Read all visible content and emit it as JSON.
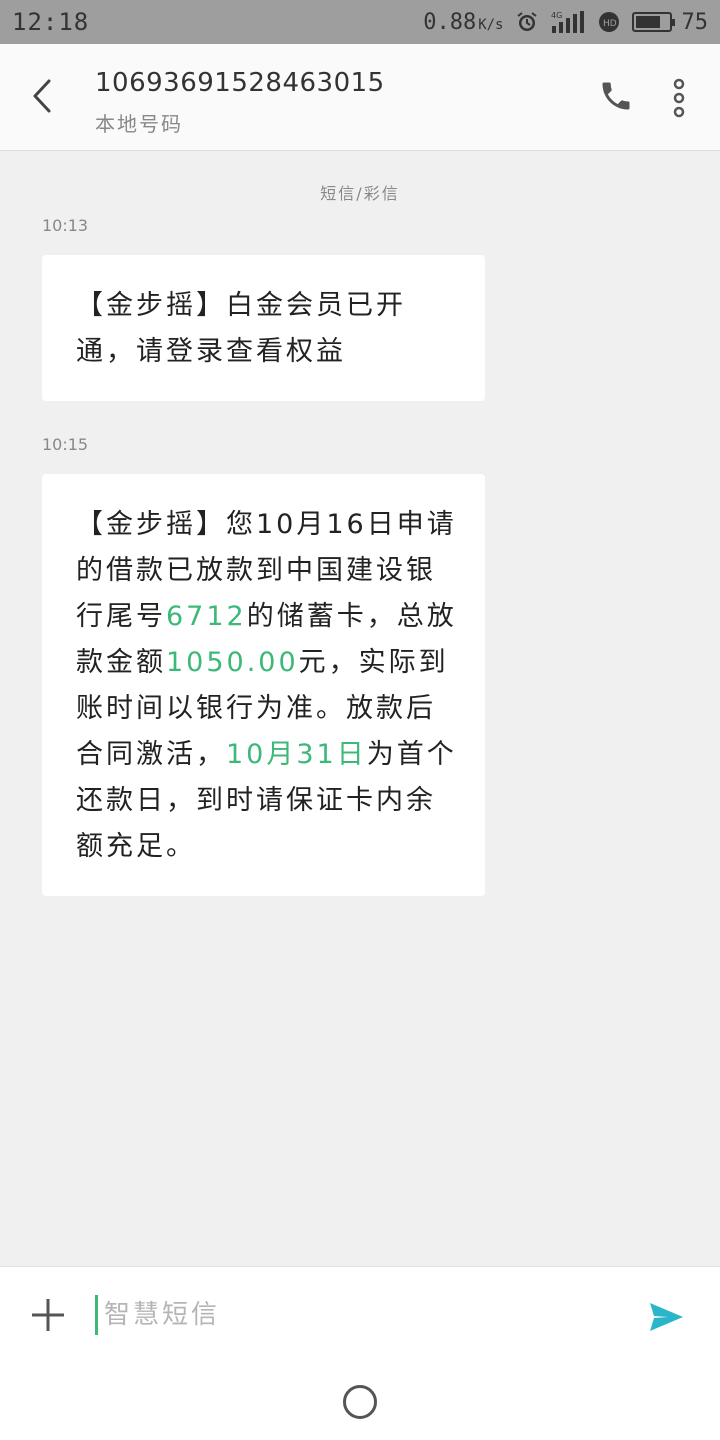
{
  "status_bar": {
    "time": "12:18",
    "net_speed": "0.88",
    "net_unit": "K/s",
    "network_type": "4G",
    "battery": "75",
    "battery_level": 0.75
  },
  "header": {
    "number": "1069369152846301​5",
    "subtitle": "本地号码"
  },
  "thread": {
    "type_label": "短信/彩信",
    "messages": [
      {
        "time": "10:13",
        "text": "【金步摇】白金会员已开通，请登录查看权益"
      },
      {
        "time": "10:15",
        "parts": [
          "【金步摇】您10月16日申请的借款已放款到中国建设银行尾号",
          "6712",
          "的储蓄卡，总放款金额",
          "1050.00",
          "元，实际到账时间以银行为准。放款后合同激活，",
          "10月31日",
          "为首个还款日，到时请保证卡内余额充足。"
        ]
      }
    ]
  },
  "input": {
    "placeholder": "智慧短信"
  },
  "colors": {
    "highlight": "#3cb878",
    "send": "#2bb5c8"
  }
}
